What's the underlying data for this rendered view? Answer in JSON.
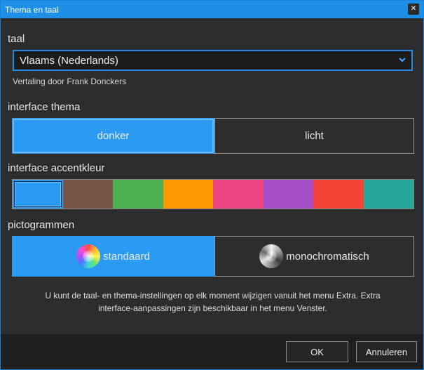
{
  "window": {
    "title": "Thema en taal",
    "close_glyph": "✕"
  },
  "language": {
    "label": "taal",
    "selected": "Vlaams (Nederlands)",
    "translator_note": "Vertaling door Frank Donckers"
  },
  "theme": {
    "label": "interface thema",
    "options": [
      "donker",
      "licht"
    ],
    "selected": "donker"
  },
  "accent": {
    "label": "interface accentkleur",
    "colors": [
      "#2b9af3",
      "#795548",
      "#4caf50",
      "#ff9800",
      "#e84582",
      "#a64ec5",
      "#f44336",
      "#26a69a"
    ],
    "selected_index": 0
  },
  "icons": {
    "label": "pictogrammen",
    "options": [
      {
        "label": "standaard",
        "icon": "color-wheel-icon"
      },
      {
        "label": "monochromatisch",
        "icon": "monochrome-wheel-icon"
      }
    ],
    "selected": "standaard"
  },
  "info": {
    "line1": "U kunt de taal- en thema-instellingen op elk moment wijzigen vanuit het menu Extra.  Extra",
    "line2": "interface-aanpassingen zijn beschikbaar in het menu Venster."
  },
  "footer": {
    "ok_label": "OK",
    "cancel_label": "Annuleren"
  },
  "colors": {
    "accent_blue": "#2b9af3",
    "titlebar_blue": "#1e8fe6",
    "background": "#2d2d2d"
  }
}
